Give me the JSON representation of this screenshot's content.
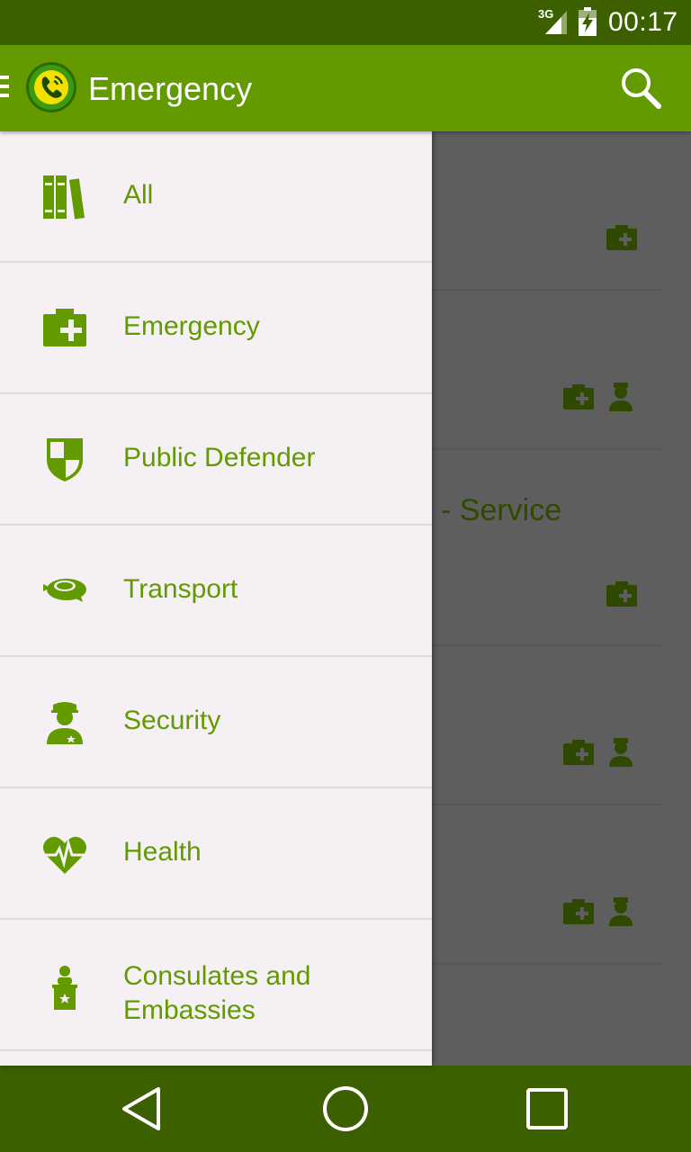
{
  "status_bar": {
    "network": "3G",
    "time": "00:17"
  },
  "app_bar": {
    "title": "Emergency"
  },
  "drawer": {
    "items": [
      {
        "label": "All",
        "icon": "books-icon"
      },
      {
        "label": "Emergency",
        "icon": "medical-kit-icon"
      },
      {
        "label": "Public Defender",
        "icon": "shield-icon"
      },
      {
        "label": "Transport",
        "icon": "vehicle-icon"
      },
      {
        "label": "Security",
        "icon": "police-officer-icon"
      },
      {
        "label": "Health",
        "icon": "heartbeat-icon"
      },
      {
        "label": "Consulates and Embassies",
        "icon": "podium-icon"
      }
    ]
  },
  "background_list": {
    "visible_text": "- Service"
  },
  "colors": {
    "primary": "#629a00",
    "dark": "#3c5f00",
    "drawer_bg": "#f4f0f4",
    "scrim": "#5e5e5e"
  }
}
